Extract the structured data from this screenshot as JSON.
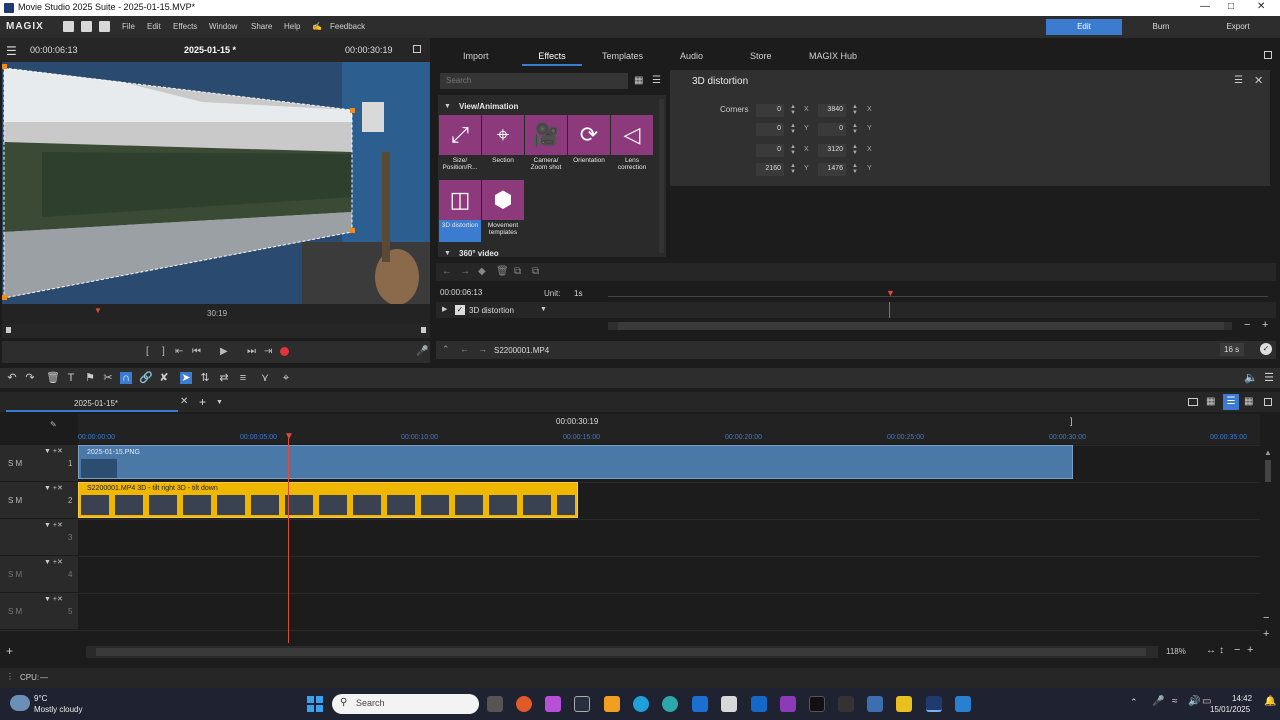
{
  "window": {
    "title": "Movie Studio 2025 Suite - 2025-01-15.MVP*"
  },
  "menubar": {
    "logo": "MAGIX",
    "items": [
      "File",
      "Edit",
      "Effects",
      "Window",
      "Share",
      "Help"
    ],
    "feedback": "Feedback",
    "modes": [
      "Edit",
      "Burn",
      "Export"
    ],
    "active_mode": "Edit"
  },
  "preview": {
    "timecode_left": "00:00:06:13",
    "project": "2025-01-15 *",
    "timecode_right": "00:00:30:19",
    "ruler_label": "30:19"
  },
  "media_tabs": {
    "items": [
      "Import",
      "Effects",
      "Templates",
      "Audio",
      "Store",
      "MAGIX Hub"
    ],
    "active": "Effects"
  },
  "effects": {
    "search_placeholder": "Search",
    "category": "View/Animation",
    "next_category": "360° video",
    "tiles": [
      {
        "label": "Size/ Position/R...",
        "icon": "resize-icon"
      },
      {
        "label": "Section",
        "icon": "crop-icon"
      },
      {
        "label": "Camera/ Zoom shot",
        "icon": "camera-icon"
      },
      {
        "label": "Orientation",
        "icon": "orientation-icon"
      },
      {
        "label": "Lens correction",
        "icon": "lens-icon"
      },
      {
        "label": "3D distortion",
        "icon": "distortion-icon",
        "selected": true
      },
      {
        "label": "Movement templates",
        "icon": "hexagon-icon"
      }
    ]
  },
  "properties": {
    "title": "3D distortion",
    "corners_label": "Corners",
    "rows": [
      {
        "a": "0",
        "a_axis": "X",
        "b": "3840",
        "b_axis": "X"
      },
      {
        "a": "0",
        "a_axis": "Y",
        "b": "0",
        "b_axis": "Y"
      },
      {
        "a": "0",
        "a_axis": "X",
        "b": "3120",
        "b_axis": "X"
      },
      {
        "a": "2160",
        "a_axis": "Y",
        "b": "1476",
        "b_axis": "Y"
      }
    ]
  },
  "keyframes": {
    "timecode": "00:00:06:13",
    "unit_label": "Unit:",
    "unit_value": "1s",
    "effect_name": "3D distortion",
    "clip_name": "S2200001.MP4",
    "duration": "16 s"
  },
  "timeline": {
    "tab": "2025-01-15*",
    "center_time": "00:00:30:19",
    "ruler": [
      "00:00:00:00",
      "00:00:05:00",
      "00:00:10:00",
      "00:00:15:00",
      "00:00:20:00",
      "00:00:25:00",
      "00:00:30:00",
      "00:00:35:00"
    ],
    "tracks": [
      "1",
      "2",
      "3",
      "4",
      "5"
    ],
    "track_controls": "S M",
    "clips": [
      {
        "name": "2025-01-15.PNG"
      },
      {
        "name": "S2200001.MP4   3D - tilt right  3D - tilt down"
      }
    ],
    "zoom": "118%"
  },
  "status": {
    "cpu": "CPU:",
    "cpu_value": "—"
  },
  "taskbar": {
    "weather_temp": "9°C",
    "weather_desc": "Mostly cloudy",
    "search": "Search",
    "time": "14:42",
    "date": "15/01/2025"
  },
  "colors": {
    "accent": "#3b7bd0",
    "effect_tile": "#8d3a7d",
    "clip_image": "#4a78a7",
    "clip_video": "#f0b700",
    "playhead": "#e04b3b"
  }
}
